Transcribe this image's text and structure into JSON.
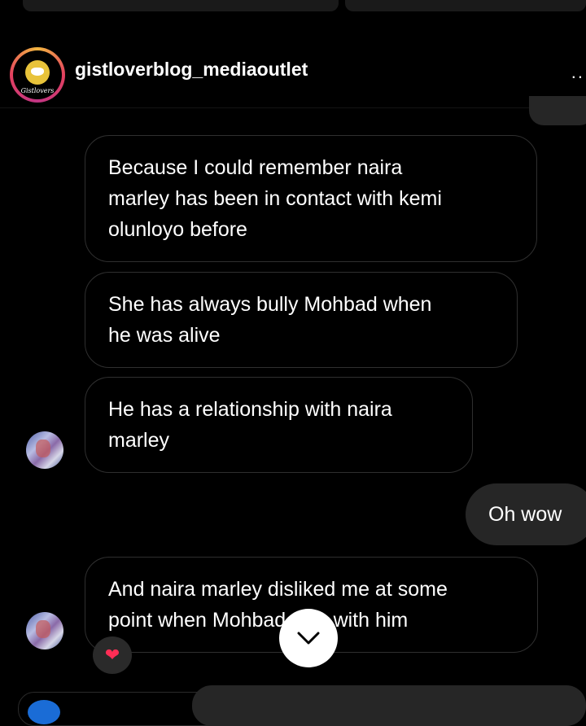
{
  "header": {
    "username": "gistloverblog_mediaoutlet",
    "avatar_text": "Gistlovers",
    "more_label": ".."
  },
  "messages": [
    {
      "from": "them",
      "lines": [
        "Because I could remember naira",
        "marley has been in contact with kemi",
        "olunloyo before"
      ]
    },
    {
      "from": "them",
      "lines": [
        "She has always bully Mohbad when",
        "he was alive"
      ]
    },
    {
      "from": "them",
      "lines": [
        "He has a relationship with naira",
        "marley"
      ]
    },
    {
      "from": "me",
      "lines": [
        "Oh wow"
      ]
    },
    {
      "from": "them",
      "lines": [
        "And naira marley disliked me at some",
        "point when Mohbad was with him"
      ]
    }
  ],
  "reaction": {
    "emoji": "❤",
    "icon": "heart-icon"
  },
  "scroll_button": {
    "icon": "chevron-down-icon"
  }
}
